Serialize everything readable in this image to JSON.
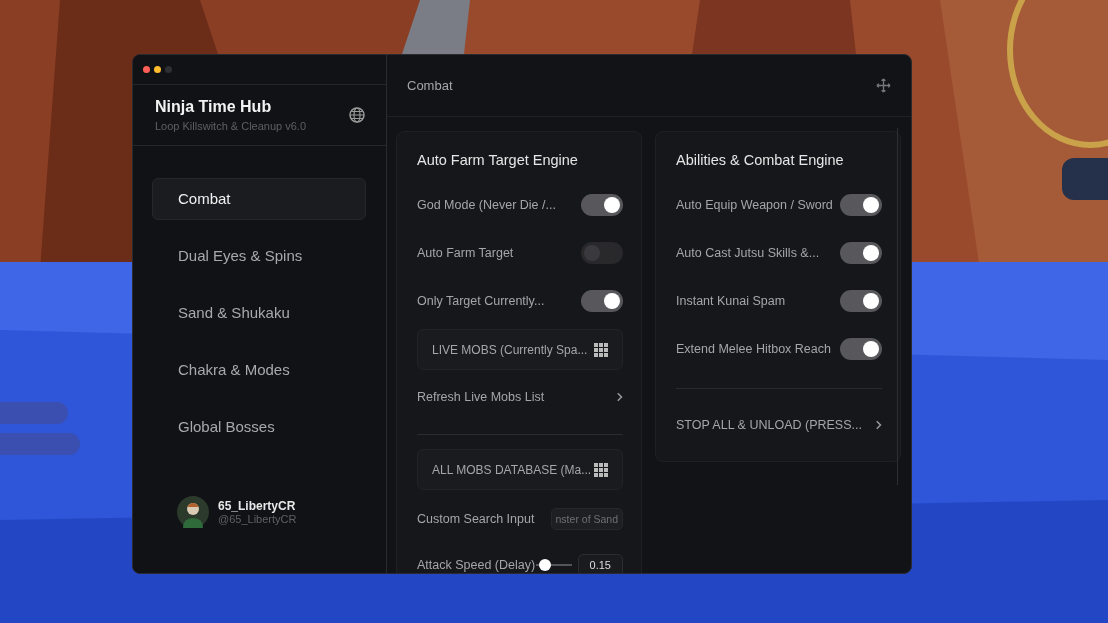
{
  "sidebar": {
    "title": "Ninja Time Hub",
    "subtitle": "Loop Killswitch & Cleanup v6.0",
    "items": [
      {
        "label": "Combat",
        "selected": true
      },
      {
        "label": "Dual Eyes & Spins",
        "selected": false
      },
      {
        "label": "Sand & Shukaku",
        "selected": false
      },
      {
        "label": "Chakra & Modes",
        "selected": false
      },
      {
        "label": "Global Bosses",
        "selected": false
      }
    ],
    "profile": {
      "name": "65_LibertyCR",
      "handle": "@65_LibertyCR"
    }
  },
  "main": {
    "title": "Combat",
    "cards": [
      {
        "title": "Auto Farm Target Engine",
        "rows": [
          {
            "kind": "toggle",
            "label": "God Mode (Never Die /...",
            "on": true
          },
          {
            "kind": "toggle",
            "label": "Auto Farm Target",
            "on": false
          },
          {
            "kind": "toggle",
            "label": "Only Target Currently...",
            "on": true
          },
          {
            "kind": "dropdown",
            "label": "LIVE MOBS (Currently Spa..."
          },
          {
            "kind": "button",
            "label": "Refresh Live Mobs List"
          },
          {
            "kind": "divider"
          },
          {
            "kind": "dropdown",
            "label": "ALL MOBS DATABASE (Ma..."
          },
          {
            "kind": "input",
            "label": "Custom Search Input",
            "value": "nster of Sand"
          },
          {
            "kind": "slider",
            "label": "Attack Speed (Delay)",
            "level": 0.15,
            "value": "0.15"
          }
        ]
      },
      {
        "title": "Abilities & Combat Engine",
        "rows": [
          {
            "kind": "toggle",
            "label": "Auto Equip Weapon / Sword",
            "on": true
          },
          {
            "kind": "toggle",
            "label": "Auto Cast Jutsu Skills &...",
            "on": true
          },
          {
            "kind": "toggle",
            "label": "Instant Kunai Spam",
            "on": true
          },
          {
            "kind": "toggle",
            "label": "Extend Melee Hitbox Reach",
            "on": true
          },
          {
            "kind": "divider"
          },
          {
            "kind": "button",
            "label": "STOP ALL & UNLOAD (PRESS..."
          }
        ]
      }
    ]
  }
}
